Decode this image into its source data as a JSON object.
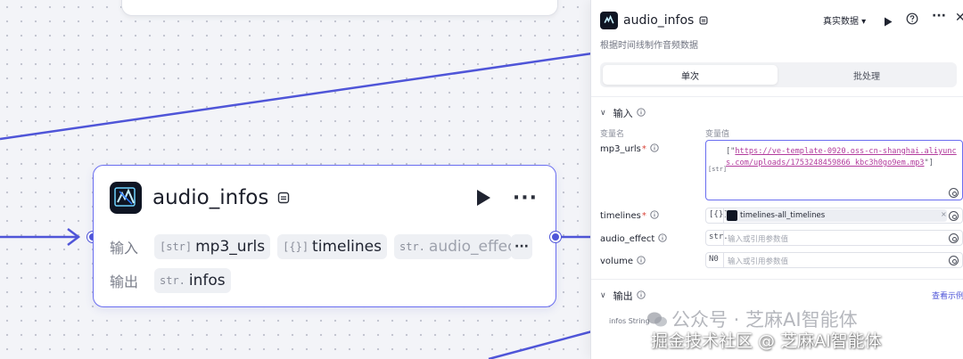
{
  "canvas": {
    "node": {
      "title": "audio_infos",
      "input_label": "输入",
      "output_label": "输出",
      "inputs": [
        {
          "type": "[str]",
          "name": "mp3_urls"
        },
        {
          "type": "[{}]",
          "name": "timelines"
        },
        {
          "type": "str.",
          "name": "audio_effec"
        }
      ],
      "outputs": [
        {
          "type": "str.",
          "name": "infos"
        }
      ],
      "more_label": "···"
    }
  },
  "panel": {
    "title": "audio_infos",
    "mode": "真实数据",
    "description": "根据时间线制作音频数据",
    "tabs": [
      {
        "label": "单次",
        "active": true
      },
      {
        "label": "批处理",
        "active": false
      }
    ],
    "input_section": {
      "title": "输入",
      "col_name": "变量名",
      "col_value": "变量值",
      "fields": [
        {
          "name": "mp3_urls",
          "required": true,
          "type": "[str]",
          "value_open": "[\"",
          "value_url": "https://ve-template-0920.oss-cn-shanghai.aliyuncs.com/uploads/1753248459866_kbc3h0go9em.mp3",
          "value_close": "\"]"
        },
        {
          "name": "timelines",
          "required": true,
          "type": "[{}]",
          "ref_node": "timelines",
          "ref_sep": " - ",
          "ref_var": "all_timelines",
          "clear": "×"
        },
        {
          "name": "audio_effect",
          "required": false,
          "type": "str.",
          "placeholder": "输入或引用参数值"
        },
        {
          "name": "volume",
          "required": false,
          "type": "N0",
          "placeholder": "输入或引用参数值"
        }
      ]
    },
    "output_section": {
      "title": "输出",
      "view_link": "查看示例",
      "items": [
        {
          "name": "infos",
          "type": "String"
        }
      ]
    }
  },
  "watermarks": {
    "wechat": "公众号 · 芝麻AI智能体",
    "juejin": "掘金技术社区 @ 芝麻AI智能体"
  },
  "colors": {
    "accent": "#4f55d8",
    "node_border": "#6a6ef0",
    "required": "#d9453a"
  }
}
